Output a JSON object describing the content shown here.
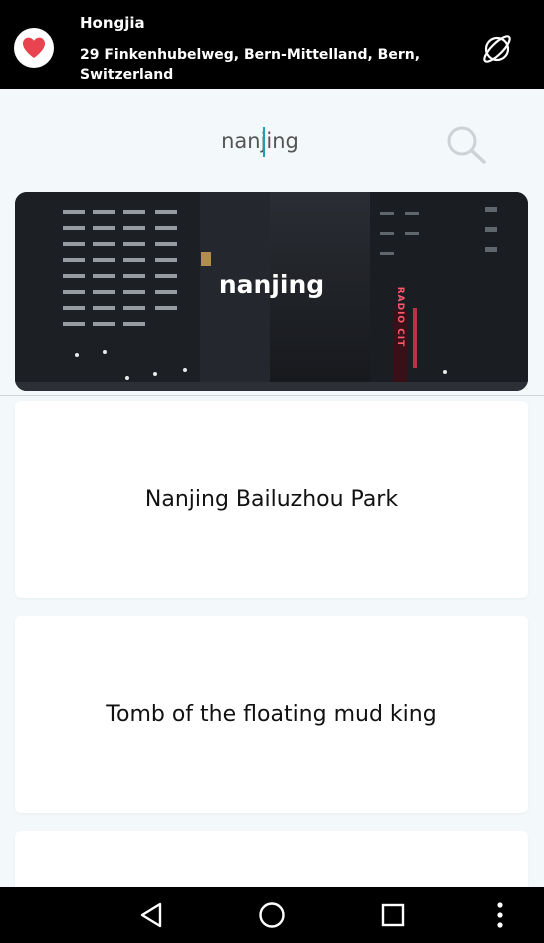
{
  "header": {
    "user_name": "Hongjia",
    "address": "29 Finkenhubelweg, Bern-Mittelland, Bern, Switzerland",
    "favorite_icon": "heart-icon",
    "explore_icon": "planet-icon"
  },
  "search": {
    "value": "nanjing",
    "icon": "search-icon"
  },
  "hero": {
    "title": "nanjing",
    "sign_text": "RADIO CIT"
  },
  "results": [
    {
      "label": "Nanjing Bailuzhou Park"
    },
    {
      "label": "Tomb of the floating mud king"
    },
    {
      "label": ""
    }
  ],
  "navbar": {
    "back_icon": "back-triangle-icon",
    "home_icon": "home-circle-icon",
    "recents_icon": "recents-square-icon",
    "menu_icon": "more-vertical-icon"
  },
  "colors": {
    "accent": "#19a1b1",
    "heart": "#e8434e",
    "bars": "#000000",
    "background": "#f3f8fa"
  }
}
